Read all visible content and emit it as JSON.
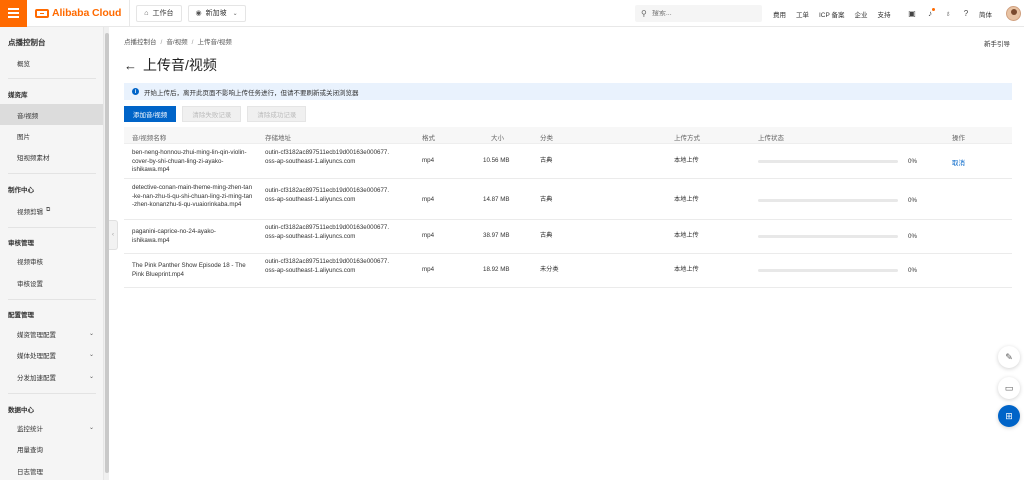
{
  "header": {
    "brand": "Alibaba Cloud",
    "workbench_label": "工作台",
    "region_label": "新加坡",
    "search_placeholder": "搜索...",
    "links": [
      "费用",
      "工单",
      "ICP 备案",
      "企业",
      "支持"
    ],
    "user_name": "简体"
  },
  "sidebar": {
    "title": "点播控制台",
    "overview": "概览",
    "groups": [
      {
        "label": "媒资库",
        "items": [
          "音/视频",
          "图片",
          "短视频素材"
        ]
      },
      {
        "label": "制作中心",
        "items": [
          "视频剪辑"
        ]
      },
      {
        "label": "审核管理",
        "items": [
          "视频审核",
          "审核设置"
        ]
      },
      {
        "label": "配置管理",
        "items": [
          "媒资管理配置",
          "媒体处理配置",
          "分发加速配置"
        ]
      },
      {
        "label": "数据中心",
        "items": [
          "监控统计",
          "用量查询",
          "日志管理"
        ]
      }
    ]
  },
  "breadcrumb": [
    "点播控制台",
    "音/视频",
    "上传音/视频"
  ],
  "help_link": "新手引导",
  "page_title": "上传音/视频",
  "notice": "开始上传后，离开此页面不影响上传任务进行，但请不要刷新或关闭浏览器",
  "actions": {
    "add": "添加音/视频",
    "clear_failed": "清除失败记录",
    "clear_success": "清除成功记录"
  },
  "table": {
    "columns": [
      "音/视频名称",
      "存储地址",
      "格式",
      "大小",
      "分类",
      "上传方式",
      "上传状态",
      "操作"
    ],
    "rows": [
      {
        "name": "ben-neng-honnou-zhui-ming-lin-qin-violin-cover-by-shi-chuan-ling-zi-ayako-ishikawa.mp4",
        "storage": "outin-cf3182ac897511ecb19d00163e000677.oss-ap-southeast-1.aliyuncs.com",
        "format": "mp4",
        "size": "10.56 MB",
        "category": "古典",
        "method": "本地上传",
        "progress": 0,
        "progress_text": "0%",
        "action": "取消"
      },
      {
        "name": "detective-conan-main-theme-ming-zhen-tan-ke-nan-zhu-ti-qu-shi-chuan-ling-zi-ming-tan-zhen-konanzhu-ti-qu-vuaiorinkaba.mp4",
        "storage": "outin-cf3182ac897511ecb19d00163e000677.oss-ap-southeast-1.aliyuncs.com",
        "format": "mp4",
        "size": "14.87 MB",
        "category": "古典",
        "method": "本地上传",
        "progress": 0,
        "progress_text": "0%",
        "action": ""
      },
      {
        "name": "paganini-caprice-no-24-ayako-ishikawa.mp4",
        "storage": "outin-cf3182ac897511ecb19d00163e000677.oss-ap-southeast-1.aliyuncs.com",
        "format": "mp4",
        "size": "38.97 MB",
        "category": "古典",
        "method": "本地上传",
        "progress": 0,
        "progress_text": "0%",
        "action": ""
      },
      {
        "name": "The Pink Panther Show Episode 18 - The Pink Blueprint.mp4",
        "storage": "outin-cf3182ac897511ecb19d00163e000677.oss-ap-southeast-1.aliyuncs.com",
        "format": "mp4",
        "size": "18.92 MB",
        "category": "未分类",
        "method": "本地上传",
        "progress": 0,
        "progress_text": "0%",
        "action": ""
      }
    ]
  },
  "colors": {
    "brand": "#ff6a00",
    "primary": "#0064c8",
    "notice_bg": "#e9f2fd"
  }
}
